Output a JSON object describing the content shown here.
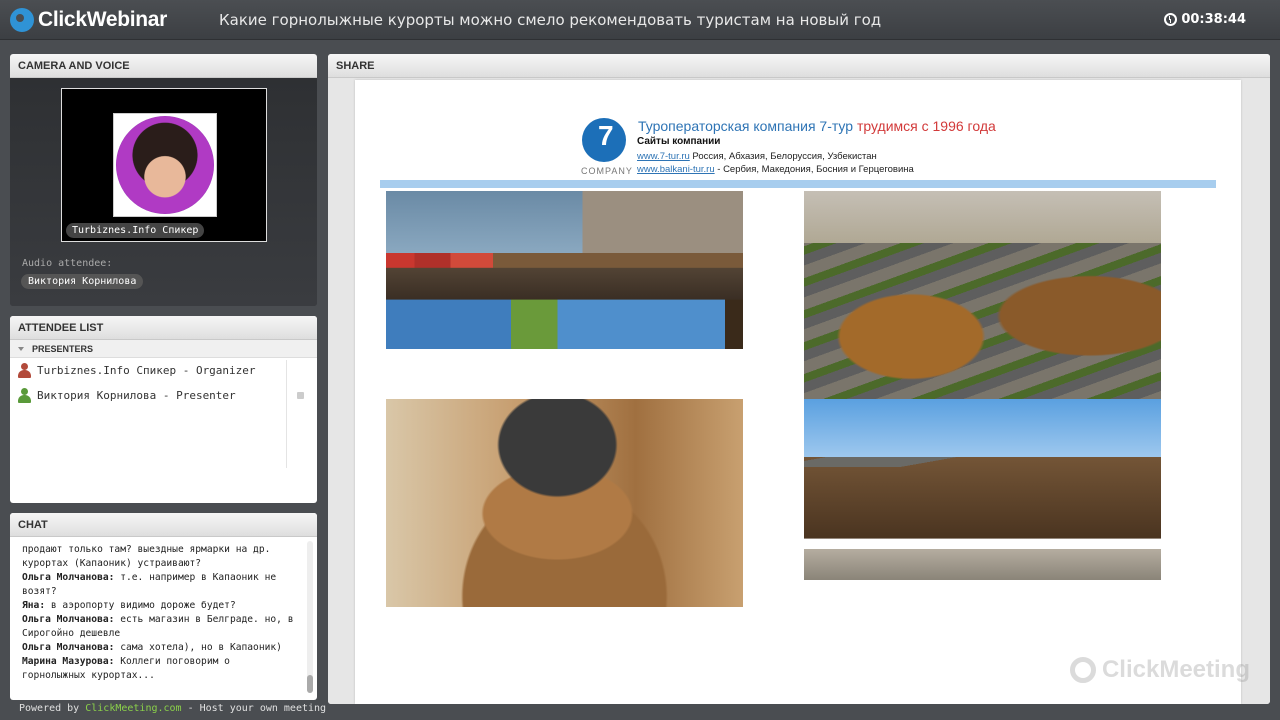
{
  "app": {
    "logo_text": "ClickWebinar",
    "title": "Какие горнолыжные курорты можно смело рекомендовать туристам на новый год",
    "timer": "00:38:44"
  },
  "camera": {
    "header": "CAMERA AND VOICE",
    "speaker_tag": "Turbiznes.Info Спикер",
    "audio_label": "Audio attendee:",
    "audio_name": "Виктория Корнилова"
  },
  "attendees": {
    "header": "ATTENDEE LIST",
    "group": "PRESENTERS",
    "items": [
      {
        "label": "Turbiznes.Info Спикер - Organizer",
        "color": "#b24a3a"
      },
      {
        "label": "Виктория Корнилова - Presenter",
        "color": "#5a9a3a"
      }
    ]
  },
  "chat": {
    "header": "CHAT",
    "lines": [
      {
        "who": "",
        "text": "продают только там? выездные ярмарки на др."
      },
      {
        "who": "",
        "text": "курортах (Капаоник) устраивают?"
      },
      {
        "who": "Ольга Молчанова:",
        "text": " т.е. например в Капаоник не"
      },
      {
        "who": "",
        "text": "возят?"
      },
      {
        "who": "Яна:",
        "text": " в аэропорту видимо дороже будет?"
      },
      {
        "who": "Ольга Молчанова:",
        "text": " есть магазин в Белграде. но, в"
      },
      {
        "who": "",
        "text": "Сирогойно дешевле"
      },
      {
        "who": "Ольга Молчанова:",
        "text": " сама хотела), но в Капаоник)"
      },
      {
        "who": "Марина Мазурова:",
        "text": " Коллеги поговорим о"
      },
      {
        "who": "",
        "text": "горнолыжных курортах..."
      }
    ]
  },
  "footer": {
    "prefix": "Powered by ",
    "link": "ClickMeeting.com",
    "suffix": " - Host your own meeting"
  },
  "share": {
    "header": "SHARE",
    "slide": {
      "logo_num": "7",
      "logo_company": "COMPANY",
      "title_main": "Туроператорская компания 7-тур ",
      "title_red": "трудимся с 1996 года",
      "subtitle": "Сайты компании",
      "site1_url": "www.7-tur.ru",
      "site1_text": "  Россия, Абхазия, Белоруссия, Узбекистан",
      "site2_url": "www.balkani-tur.ru",
      "site2_text": " - Сербия, Македония, Босния и Герцеговина"
    },
    "watermark": "ClickMeeting"
  }
}
